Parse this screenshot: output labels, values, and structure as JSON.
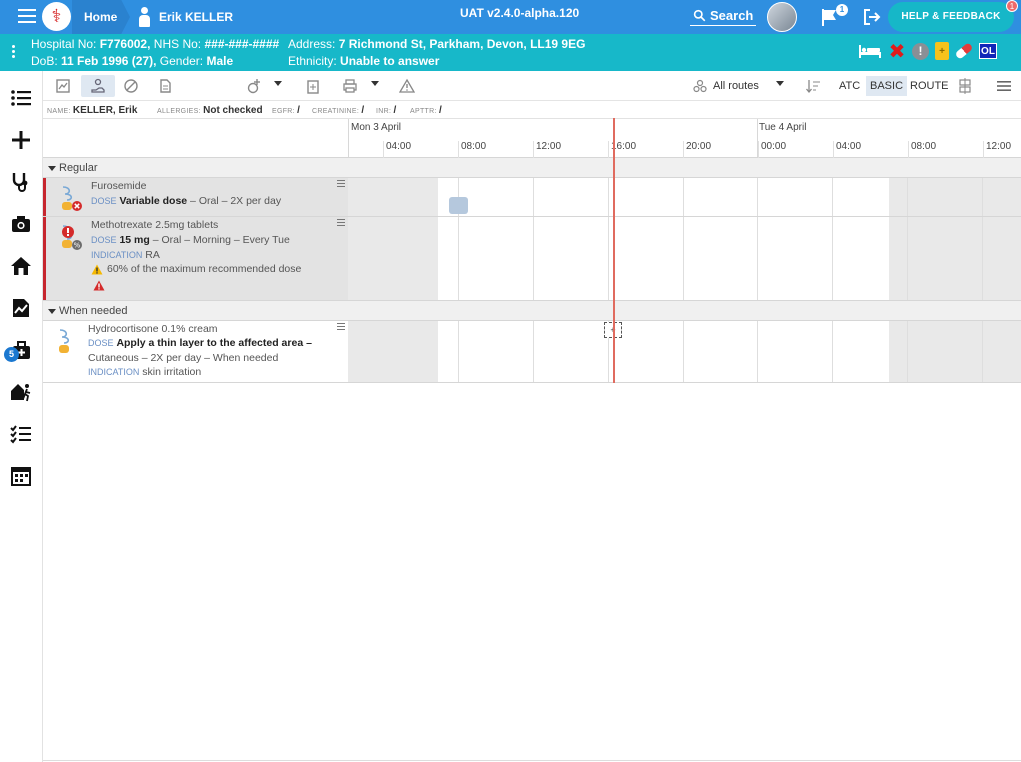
{
  "topbar": {
    "home_label": "Home",
    "patient_name": "Erik KELLER",
    "version": "UAT v2.4.0-alpha.120",
    "search_label": "Search",
    "flag_count": "1",
    "help_label": "HELP & FEEDBACK",
    "help_badge": "1"
  },
  "banner": {
    "hospital_no_label": "Hospital No:",
    "hospital_no": "F776002,",
    "nhs_label": "NHS No:",
    "nhs_no": "###-###-####",
    "address_label": "Address:",
    "address": "7 Richmond St, Parkham, Devon, LL19 9EG",
    "dob_label": "DoB:",
    "dob": "11 Feb 1996 (27),",
    "gender_label": "Gender:",
    "gender": "Male",
    "ethnicity_label": "Ethnicity:",
    "ethnicity": "Unable to answer",
    "icons": [
      "bed-icon",
      "close-icon",
      "alert-icon",
      "clipboard-icon",
      "pill-icon",
      "ol-badge"
    ],
    "ol_text": "OL"
  },
  "sidebar": {
    "badge_count": "5",
    "items": [
      "list-icon",
      "plus-icon",
      "stethoscope-icon",
      "camera-icon",
      "home-icon",
      "chart-doc-icon",
      "medical-bag-icon",
      "walking-house-icon",
      "checklist-icon",
      "calendar-grid-icon"
    ]
  },
  "toolbar": {
    "routes_label": "All routes",
    "atc_label": "ATC",
    "basic_label": "BASIC",
    "route_label": "ROUTE"
  },
  "infostrip": {
    "name_label": "NAME:",
    "name": "KELLER, Erik",
    "allergies_label": "ALLERGIES:",
    "allergies": "Not checked",
    "egfr_label": "EGFR:",
    "egfr": "/",
    "creatinine_label": "CREATININE:",
    "creatinine": "/",
    "inr_label": "INR:",
    "inr": "/",
    "apttr_label": "APTTR:",
    "apttr": "/"
  },
  "timeline": {
    "days": [
      "Mon 3 April",
      "Tue 4 April"
    ],
    "hours": [
      "04:00",
      "08:00",
      "12:00",
      "16:00",
      "20:00",
      "00:00",
      "04:00",
      "08:00",
      "12:00"
    ]
  },
  "groups": {
    "regular": "Regular",
    "when_needed": "When needed"
  },
  "meds": [
    {
      "name": "Furosemide",
      "dose_label": "DOSE",
      "dose": "Variable dose",
      "dose_rest": " – Oral – 2X per day"
    },
    {
      "name": "Methotrexate 2.5mg tablets",
      "dose_label": "DOSE",
      "dose": "15 mg",
      "dose_rest": " – Oral – Morning – Every Tue",
      "indication_label": "INDICATION",
      "indication": "RA",
      "warning": "60% of the maximum recommended dose"
    },
    {
      "name": "Hydrocortisone 0.1% cream",
      "dose_label": "DOSE",
      "dose": "Apply a thin layer to the affected area –",
      "dose_rest2": "Cutaneous – 2X per day – When needed",
      "indication_label": "INDICATION",
      "indication": "skin irritation",
      "add_symbol": "+"
    }
  ],
  "colors": {
    "topbar": "#2f8fe0",
    "banner": "#17b8c9",
    "stop_bar": "#c6262e",
    "now_line": "#e06b5f"
  }
}
